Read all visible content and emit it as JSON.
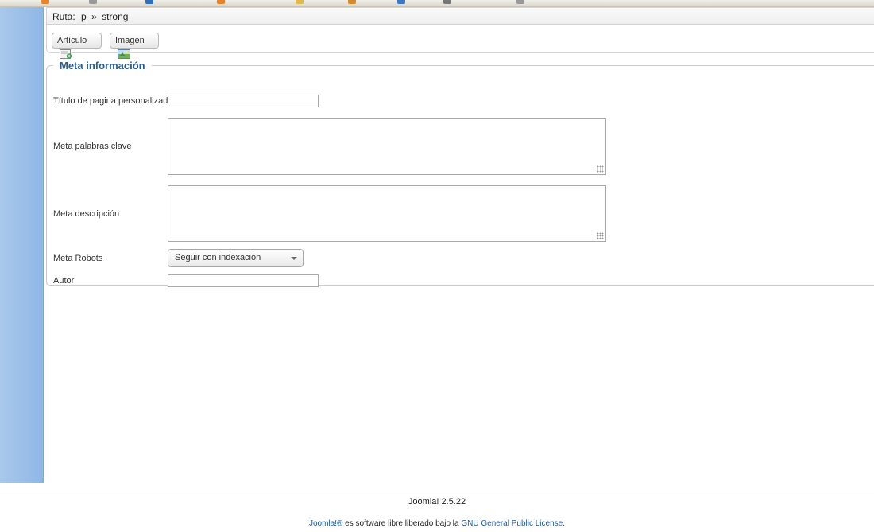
{
  "path_bar": {
    "label": "Ruta:",
    "p": "p",
    "separator": "»",
    "strong": "strong"
  },
  "editor_buttons": {
    "article_label": "Artículo",
    "image_label": "Imagen"
  },
  "meta_section": {
    "legend": "Meta información",
    "custom_title_label": "Título de pagina personalizado",
    "custom_title_value": "",
    "keywords_label": "Meta palabras clave",
    "keywords_value": "",
    "description_label": "Meta descripción",
    "description_value": "",
    "robots_label": "Meta Robots",
    "robots_selected": "Seguir con indexación",
    "author_label": "Autor",
    "author_value": ""
  },
  "footer": {
    "version": "Joomla! 2.5.22",
    "license_brand": "Joomla!®",
    "license_text": "es software libre liberado bajo la",
    "license_link": "GNU General Public License",
    "license_end": "."
  },
  "colors": {
    "sidebar": "#a9c8ec",
    "legend": "#2c5d8f",
    "link": "#1f5aa0"
  }
}
